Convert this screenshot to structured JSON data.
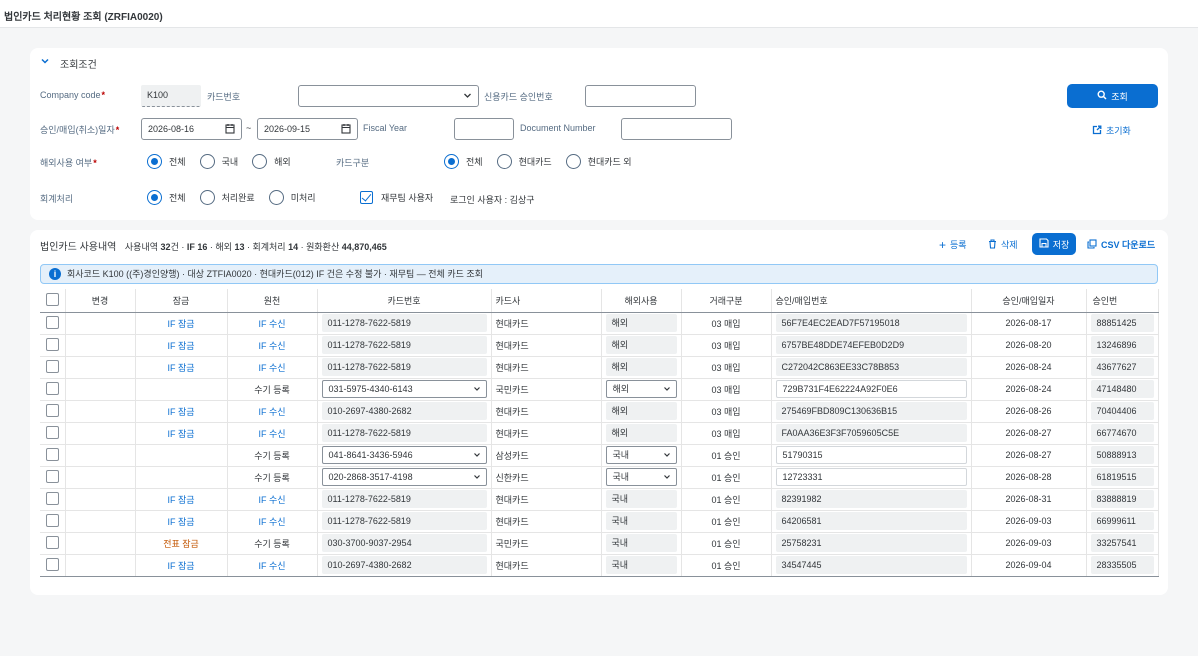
{
  "app": {
    "title": "법인카드 처리현황 조회 (ZRFIA0020)"
  },
  "filter": {
    "section_title": "조회조건",
    "company_code": {
      "label": "Company code",
      "value": "K100"
    },
    "card_no": {
      "label": "카드번호",
      "value": ""
    },
    "approval_no": {
      "label": "신용카드 승인번호",
      "value": ""
    },
    "date": {
      "label": "승인/매입(취소)일자",
      "from": "2026-08-16",
      "to": "2026-09-15",
      "sep": "~"
    },
    "fiscal_year": {
      "label": "Fiscal Year",
      "value": ""
    },
    "document_number": {
      "label": "Document Number",
      "value": ""
    },
    "overseas": {
      "label": "해외사용 여부",
      "options": [
        "전체",
        "국내",
        "해외"
      ],
      "selected": "전체"
    },
    "card_type": {
      "label": "카드구분",
      "options": [
        "전체",
        "현대카드",
        "현대카드 외"
      ],
      "selected": "전체"
    },
    "accounting": {
      "label": "회계처리",
      "options": [
        "전체",
        "처리완료",
        "미처리"
      ],
      "selected": "전체"
    },
    "finance_user": {
      "label": "재무팀 사용자",
      "checked": true
    },
    "login_user": "로그인 사용자 : 김상구",
    "search_label": "조회",
    "reset_label": "초기화"
  },
  "list": {
    "title": "법인카드 사용내역",
    "summary": {
      "t1": "사용내역",
      "total": "32",
      "t2": "건 · ",
      "if_label": "IF",
      "if_count": "16",
      "t3": " · 해외",
      "overseas_count": "13",
      "t4": " · 회계처리",
      "acct_count": "14",
      "t5": " · 원화환산",
      "krw_amount": "44,870,465"
    },
    "actions": {
      "add": "등록",
      "delete": "삭제",
      "save": "저장",
      "csv": "CSV 다운로드"
    },
    "info": "회사코드 K100 ((주)경인양행) · 대상 ZTFIA0020 · 현대카드(012) IF 건은 수정 불가 · 재무팀 — 전체 카드 조회",
    "columns": [
      "변경",
      "잠금",
      "원천",
      "카드번호",
      "카드사",
      "해외사용",
      "거래구분",
      "승인/매입번호",
      "승인/매입일자",
      "승인번"
    ],
    "rows": [
      {
        "lock": "IF 잠금",
        "source": "IF 수신",
        "card": "011-1278-7622-5819",
        "company": "현대카드",
        "overseas": "해외",
        "deal": "03 매입",
        "appr": "56F7E4EC2EAD7F57195018",
        "date": "2026-08-17",
        "ano": "88851425",
        "editable": false
      },
      {
        "lock": "IF 잠금",
        "source": "IF 수신",
        "card": "011-1278-7622-5819",
        "company": "현대카드",
        "overseas": "해외",
        "deal": "03 매입",
        "appr": "6757BE48DDE74EFEB0D2D9",
        "date": "2026-08-20",
        "ano": "13246896",
        "editable": false
      },
      {
        "lock": "IF 잠금",
        "source": "IF 수신",
        "card": "011-1278-7622-5819",
        "company": "현대카드",
        "overseas": "해외",
        "deal": "03 매입",
        "appr": "C272042C863EE33C78B853",
        "date": "2026-08-24",
        "ano": "43677627",
        "editable": false
      },
      {
        "lock": "",
        "source": "수기 등록",
        "card": "031-5975-4340-6143",
        "company": "국민카드",
        "overseas": "해외",
        "deal": "03 매입",
        "appr": "729B731F4E62224A92F0E6",
        "date": "2026-08-24",
        "ano": "47148480",
        "editable": true
      },
      {
        "lock": "IF 잠금",
        "source": "IF 수신",
        "card": "010-2697-4380-2682",
        "company": "현대카드",
        "overseas": "해외",
        "deal": "03 매입",
        "appr": "275469FBD809C130636B15",
        "date": "2026-08-26",
        "ano": "70404406",
        "editable": false
      },
      {
        "lock": "IF 잠금",
        "source": "IF 수신",
        "card": "011-1278-7622-5819",
        "company": "현대카드",
        "overseas": "해외",
        "deal": "03 매입",
        "appr": "FA0AA36E3F3F7059605C5E",
        "date": "2026-08-27",
        "ano": "66774670",
        "editable": false
      },
      {
        "lock": "",
        "source": "수기 등록",
        "card": "041-8641-3436-5946",
        "company": "삼성카드",
        "overseas": "국내",
        "deal": "01 승인",
        "appr": "51790315",
        "date": "2026-08-27",
        "ano": "50888913",
        "editable": true
      },
      {
        "lock": "",
        "source": "수기 등록",
        "card": "020-2868-3517-4198",
        "company": "신한카드",
        "overseas": "국내",
        "deal": "01 승인",
        "appr": "12723331",
        "date": "2026-08-28",
        "ano": "61819515",
        "editable": true
      },
      {
        "lock": "IF 잠금",
        "source": "IF 수신",
        "card": "011-1278-7622-5819",
        "company": "현대카드",
        "overseas": "국내",
        "deal": "01 승인",
        "appr": "82391982",
        "date": "2026-08-31",
        "ano": "83888819",
        "editable": false
      },
      {
        "lock": "IF 잠금",
        "source": "IF 수신",
        "card": "011-1278-7622-5819",
        "company": "현대카드",
        "overseas": "국내",
        "deal": "01 승인",
        "appr": "64206581",
        "date": "2026-09-03",
        "ano": "66999611",
        "editable": false
      },
      {
        "lock": "전표 잠금",
        "source": "수기 등록",
        "card": "030-3700-9037-2954",
        "company": "국민카드",
        "overseas": "국내",
        "deal": "01 승인",
        "appr": "25758231",
        "date": "2026-09-03",
        "ano": "33257541",
        "editable": false
      },
      {
        "lock": "IF 잠금",
        "source": "IF 수신",
        "card": "010-2697-4380-2682",
        "company": "현대카드",
        "overseas": "국내",
        "deal": "01 승인",
        "appr": "34547445",
        "date": "2026-09-04",
        "ano": "28335505",
        "editable": false
      }
    ]
  },
  "colors": {
    "accent": "#0a6ed1",
    "warn": "#c35500",
    "required": "#bb0000"
  }
}
